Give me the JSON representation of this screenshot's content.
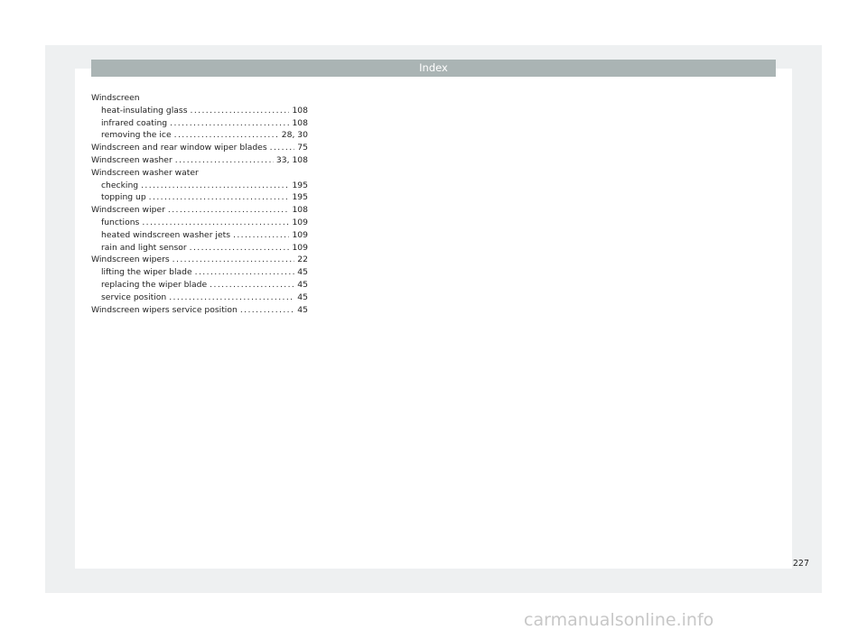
{
  "header": {
    "title": "Index"
  },
  "index": [
    {
      "type": "head",
      "text": "Windscreen"
    },
    {
      "type": "sub",
      "text": "heat-insulating glass",
      "page": "108"
    },
    {
      "type": "sub",
      "text": "infrared coating",
      "page": "108"
    },
    {
      "type": "sub",
      "text": "removing the ice",
      "page": "28, 30"
    },
    {
      "type": "main",
      "text": "Windscreen and rear window wiper blades",
      "page": "75"
    },
    {
      "type": "main",
      "text": "Windscreen washer",
      "page": "33, 108"
    },
    {
      "type": "head",
      "text": "Windscreen washer water"
    },
    {
      "type": "sub",
      "text": "checking",
      "page": "195"
    },
    {
      "type": "sub",
      "text": "topping up",
      "page": "195"
    },
    {
      "type": "main",
      "text": "Windscreen wiper",
      "page": "108"
    },
    {
      "type": "sub",
      "text": "functions",
      "page": "109"
    },
    {
      "type": "sub",
      "text": "heated windscreen washer jets",
      "page": "109"
    },
    {
      "type": "sub",
      "text": "rain and light sensor",
      "page": "109"
    },
    {
      "type": "main",
      "text": "Windscreen wipers",
      "page": "22"
    },
    {
      "type": "sub",
      "text": "lifting the wiper blade",
      "page": "45"
    },
    {
      "type": "sub",
      "text": "replacing the wiper blade",
      "page": "45"
    },
    {
      "type": "sub",
      "text": "service position",
      "page": "45"
    },
    {
      "type": "main",
      "text": "Windscreen wipers service position",
      "page": "45"
    }
  ],
  "footer": {
    "page_number": "227"
  },
  "watermark": {
    "text": "carmanualsonline.info"
  }
}
